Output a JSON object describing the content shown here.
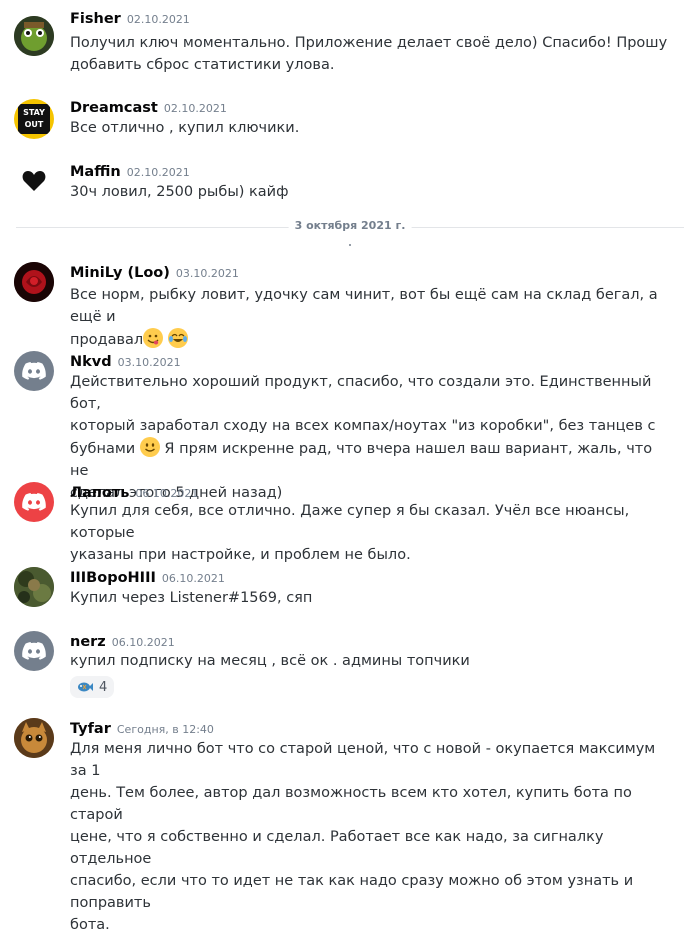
{
  "messages": [
    {
      "author": "Fisher",
      "time": "02.10.2021",
      "lines": [
        "Получил ключ моментально. Приложение делает своё дело) Спасибо! Прошу",
        "добавить сброс статистики улова."
      ]
    },
    {
      "author": "Dreamcast",
      "time": "02.10.2021",
      "lines": [
        "Все отлично , купил ключики."
      ],
      "avatar_text": "STAY OUT"
    },
    {
      "author": "Maffin",
      "time": "02.10.2021",
      "lines": [
        "30ч ловил, 2500 рыбы) кайф"
      ]
    },
    {
      "author": "MiniLy (Loo)",
      "time": "03.10.2021",
      "lines": [
        "Все норм, рыбку ловит, удочку сам чинит, вот бы ещё сам на склад бегал, а ещё и",
        "продавал"
      ]
    },
    {
      "author": "Nkvd",
      "time": "03.10.2021",
      "lines": [
        "Действительно хороший продукт, спасибо, что создали это. Единственный бот,",
        "который заработал сходу на всех компах/ноутах \"из коробки\", без танцев с",
        "бубнами",
        "Я прям искренне рад, что вчера нашел ваш вариант, жаль, что не",
        "сделал этого 5 дней назад)"
      ]
    },
    {
      "author": "Лапоть",
      "time": "06.10.2021",
      "lines": [
        "Купил для себя, все отлично. Даже супер я бы сказал. Учёл все нюансы, которые",
        "указаны при настройке, и проблем не было."
      ]
    },
    {
      "author": "IIIBороHIII",
      "time": "06.10.2021",
      "lines": [
        "Купил через Listener#1569, сяп"
      ]
    },
    {
      "author": "nerz",
      "time": "06.10.2021",
      "lines": [
        "купил подписку на месяц , всё ок . админы топчики"
      ],
      "reaction_count": "4"
    },
    {
      "author": "Tyfar",
      "time": "Сегодня, в 12:40",
      "lines": [
        "Для меня лично бот что со старой ценой, что с новой - окупается максимум за 1",
        "день. Тем более, автор дал возможность всем кто хотел, купить бота по старой",
        "цене, что я собственно и сделал. Работает все как надо, за сигналку отдельное",
        "спасибо, если что то идет не так как надо сразу можно об этом узнать и поправить",
        "бота."
      ]
    }
  ],
  "date_divider": "3 октября 2021 г.",
  "colors": {
    "discord_blurple": "#5865f2",
    "discord_red": "#ed4245",
    "discord_grey": "#747f8d"
  }
}
